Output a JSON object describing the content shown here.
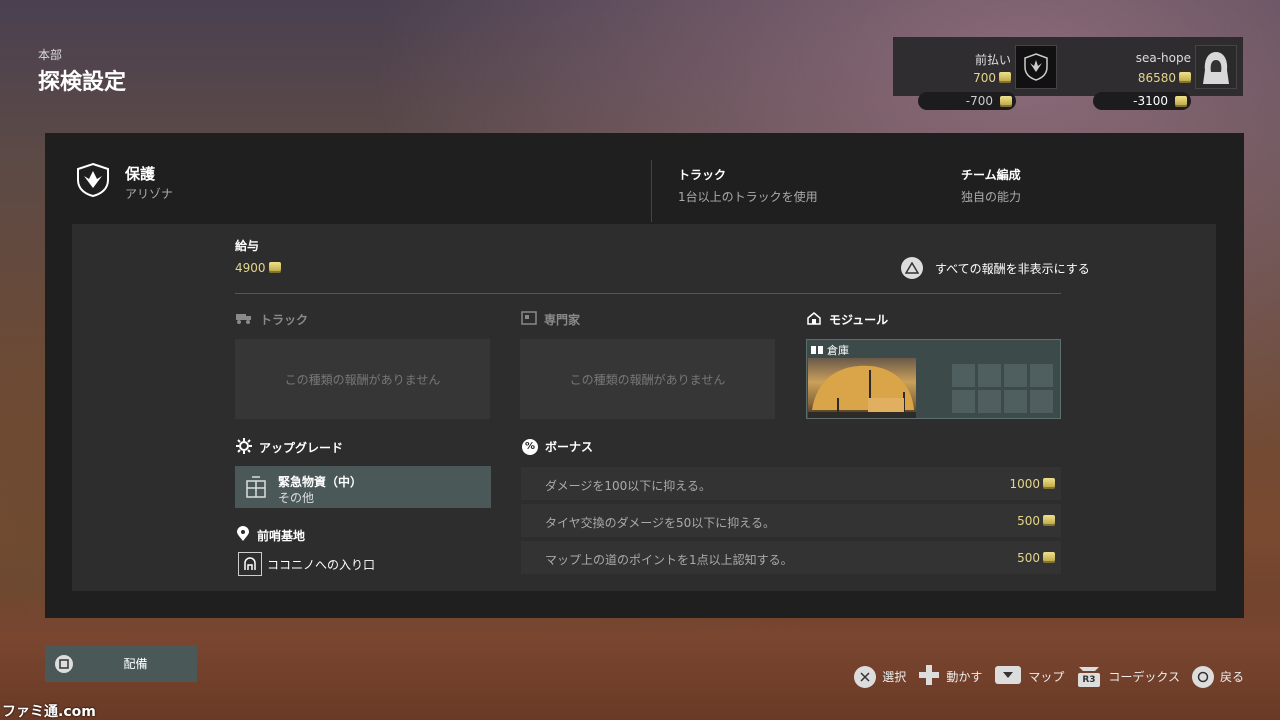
{
  "header": {
    "section": "本部",
    "title": "探検設定"
  },
  "players": [
    {
      "name": "前払い",
      "value": "700",
      "delta": "-700"
    },
    {
      "name": "sea-hope",
      "value": "86580",
      "delta": "-3100"
    }
  ],
  "contract": {
    "title": "保護",
    "location": "アリゾナ",
    "requirements": [
      {
        "title": "トラック",
        "desc": "1台以上のトラックを使用"
      },
      {
        "title": "チーム編成",
        "desc": "独自の能力"
      }
    ]
  },
  "salary": {
    "label": "給与",
    "value": "4900"
  },
  "toggle_rewards": "すべての報酬を非表示にする",
  "rewards": {
    "truck": {
      "label": "トラック",
      "empty": "この種類の報酬がありません"
    },
    "specialist": {
      "label": "専門家",
      "empty": "この種類の報酬がありません"
    },
    "module": {
      "label": "モジュール",
      "item": "倉庫"
    }
  },
  "upgrade": {
    "label": "アップグレード",
    "item_title": "緊急物資（中）",
    "item_sub": "その他"
  },
  "bonus": {
    "label": "ボーナス",
    "rows": [
      {
        "text": "ダメージを100以下に抑える。",
        "value": "1000"
      },
      {
        "text": "タイヤ交換のダメージを50以下に抑える。",
        "value": "500"
      },
      {
        "text": "マップ上の道のポイントを1点以上認知する。",
        "value": "500"
      }
    ]
  },
  "outpost": {
    "label": "前哨基地",
    "item": "ココニノへの入り口"
  },
  "deploy_label": "配備",
  "footer": {
    "select": "選択",
    "move": "動かす",
    "map": "マップ",
    "codex": "コーデックス",
    "back": "戻る",
    "r3": "R3"
  },
  "watermark": "ファミ通.com"
}
